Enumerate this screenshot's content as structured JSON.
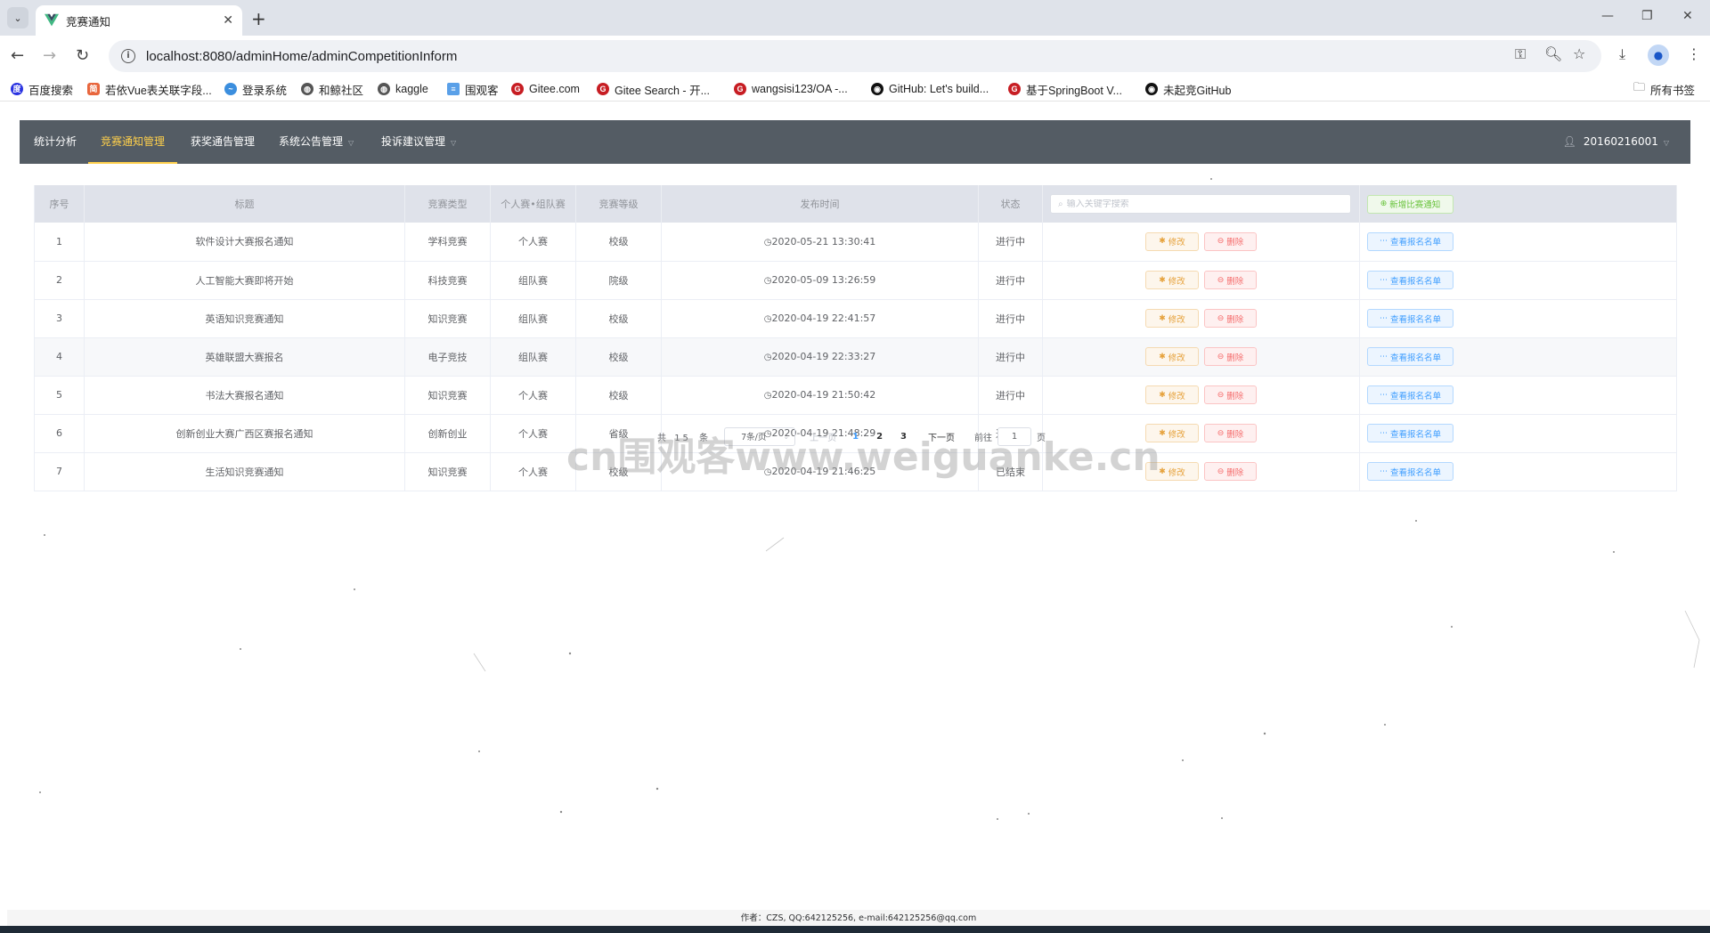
{
  "browser": {
    "tab_title": "竞赛通知",
    "new_tab": "+",
    "url": "localhost:8080/adminHome/adminCompetitionInform",
    "bookmarks": [
      {
        "label": "百度搜索",
        "icon": "baidu-icon",
        "color": "#2932e1"
      },
      {
        "label": "若依Vue表关联字段...",
        "icon": "jian-icon",
        "color": "#e8663d"
      },
      {
        "label": "登录系统",
        "icon": "ruoyi-icon",
        "color": "#3b8ede"
      },
      {
        "label": "和鲸社区",
        "icon": "globe-icon",
        "color": "#555555"
      },
      {
        "label": "kaggle",
        "icon": "globe-icon",
        "color": "#555555"
      },
      {
        "label": "围观客",
        "icon": "bars-icon",
        "color": "#5aa0e8"
      },
      {
        "label": "Gitee.com",
        "icon": "gitee-icon",
        "color": "#c71d23"
      },
      {
        "label": "Gitee Search - 开...",
        "icon": "gitee-icon",
        "color": "#c71d23"
      },
      {
        "label": "wangsisi123/OA -...",
        "icon": "gitee-icon",
        "color": "#c71d23"
      },
      {
        "label": "GitHub: Let's build...",
        "icon": "github-icon",
        "color": "#111111"
      },
      {
        "label": "基于SpringBoot V...",
        "icon": "gitee-icon",
        "color": "#c71d23"
      },
      {
        "label": "未起竞GitHub",
        "icon": "github-icon",
        "color": "#111111"
      }
    ],
    "all_bookmarks": "所有书签"
  },
  "nav": {
    "items": [
      {
        "label": "统计分析",
        "active": false,
        "dropdown": false
      },
      {
        "label": "竞赛通知管理",
        "active": true,
        "dropdown": false
      },
      {
        "label": "获奖通告管理",
        "active": false,
        "dropdown": false
      },
      {
        "label": "系统公告管理",
        "active": false,
        "dropdown": true
      },
      {
        "label": "投诉建议管理",
        "active": false,
        "dropdown": true
      }
    ],
    "user": "20160216001"
  },
  "table": {
    "headers": [
      "序号",
      "标题",
      "竞赛类型",
      "个人赛•组队赛",
      "竞赛等级",
      "发布时间",
      "状态"
    ],
    "search_placeholder": "输入关键字搜索",
    "add_label": "新增比赛通知",
    "edit_label": "修改",
    "delete_label": "删除",
    "view_label": "查看报名名单",
    "rows": [
      {
        "no": "1",
        "title": "软件设计大赛报名通知",
        "type": "学科竞赛",
        "mode": "个人赛",
        "level": "校级",
        "time": "2020-05-21 13:30:41",
        "status": "进行中"
      },
      {
        "no": "2",
        "title": "人工智能大赛即将开始",
        "type": "科技竞赛",
        "mode": "组队赛",
        "level": "院级",
        "time": "2020-05-09 13:26:59",
        "status": "进行中"
      },
      {
        "no": "3",
        "title": "英语知识竞赛通知",
        "type": "知识竞赛",
        "mode": "组队赛",
        "level": "校级",
        "time": "2020-04-19 22:41:57",
        "status": "进行中"
      },
      {
        "no": "4",
        "title": "英雄联盟大赛报名",
        "type": "电子竞技",
        "mode": "组队赛",
        "level": "校级",
        "time": "2020-04-19 22:33:27",
        "status": "进行中"
      },
      {
        "no": "5",
        "title": "书法大赛报名通知",
        "type": "知识竞赛",
        "mode": "个人赛",
        "level": "校级",
        "time": "2020-04-19 21:50:42",
        "status": "进行中"
      },
      {
        "no": "6",
        "title": "创新创业大赛广西区赛报名通知",
        "type": "创新创业",
        "mode": "个人赛",
        "level": "省级",
        "time": "2020-04-19 21:48:29",
        "status": "进行中"
      },
      {
        "no": "7",
        "title": "生活知识竞赛通知",
        "type": "知识竞赛",
        "mode": "个人赛",
        "level": "校级",
        "time": "2020-04-19 21:46:25",
        "status": "已结束"
      }
    ]
  },
  "pagination": {
    "total_prefix": "共",
    "total": "15",
    "total_suffix": "条",
    "page_size": "7条/页",
    "prev": "上一页",
    "pages": [
      "1",
      "2",
      "3"
    ],
    "current": "1",
    "next": "下一页",
    "goto_prefix": "前往",
    "goto_value": "1",
    "goto_suffix": "页"
  },
  "watermark": "cn围观客www.weiguanke.cn",
  "footer": "作者：CZS, QQ:642125256, e-mail:642125256@qq.com",
  "colors": {
    "menu_bg": "#545c64",
    "menu_active": "#ffd04b",
    "primary": "#409eff",
    "success": "#67c23a",
    "warning": "#e6a23c",
    "danger": "#f56c6c"
  }
}
